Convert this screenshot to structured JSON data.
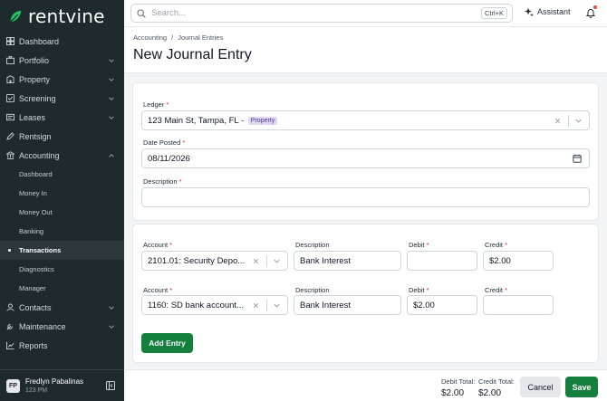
{
  "app": {
    "brand": "rentvine",
    "brand_color": "#15803d",
    "sidebar_bg": "#1f2a2e"
  },
  "topbar": {
    "search_placeholder": "Search...",
    "search_shortcut": "Ctrl+K",
    "assistant_label": "Assistant",
    "notifications_unread": true
  },
  "sidebar": {
    "items": [
      {
        "label": "Dashboard",
        "icon": "dashboard-icon"
      },
      {
        "label": "Portfolio",
        "icon": "portfolio-icon",
        "expandable": true
      },
      {
        "label": "Property",
        "icon": "building-icon",
        "expandable": true
      },
      {
        "label": "Screening",
        "icon": "screening-icon",
        "expandable": true
      },
      {
        "label": "Leases",
        "icon": "lease-icon",
        "expandable": true
      },
      {
        "label": "Rentsign",
        "icon": "pen-icon"
      },
      {
        "label": "Accounting",
        "icon": "bank-icon",
        "expandable": true,
        "expanded": true
      }
    ],
    "accounting_sub": [
      {
        "label": "Dashboard"
      },
      {
        "label": "Money In"
      },
      {
        "label": "Money Out"
      },
      {
        "label": "Banking"
      },
      {
        "label": "Transactions",
        "active": true
      },
      {
        "label": "Diagnostics"
      },
      {
        "label": "Manager"
      }
    ],
    "items_after": [
      {
        "label": "Contacts",
        "icon": "contacts-icon",
        "expandable": true
      },
      {
        "label": "Maintenance",
        "icon": "wrench-icon",
        "expandable": true
      },
      {
        "label": "Reports",
        "icon": "chart-icon"
      }
    ],
    "user": {
      "initials": "FP",
      "name": "Fredlyn Pabalinas",
      "subtitle": "123 PM"
    }
  },
  "header": {
    "breadcrumb": [
      "Accounting",
      "Journal Entries"
    ],
    "breadcrumb_sep": "/",
    "title": "New Journal Entry"
  },
  "form": {
    "ledger": {
      "label": "Ledger",
      "value": "123 Main St, Tampa, FL -",
      "badge": "Property"
    },
    "date_posted": {
      "label": "Date Posted",
      "value": "08/11/2026"
    },
    "description": {
      "label": "Description",
      "value": ""
    }
  },
  "lines": {
    "headers": {
      "account": "Account",
      "description": "Description",
      "debit": "Debit",
      "credit": "Credit"
    },
    "rows": [
      {
        "account": "2101.01: Security Depo...",
        "description": "Bank Interest",
        "debit": "",
        "credit": "$2.00"
      },
      {
        "account": "1160: SD bank account...",
        "description": "Bank Interest",
        "debit": "$2.00",
        "credit": ""
      }
    ],
    "add_label": "Add Entry"
  },
  "footer": {
    "debit_total_label": "Debit Total:",
    "debit_total": "$2.00",
    "credit_total_label": "Credit Total:",
    "credit_total": "$2.00",
    "cancel_label": "Cancel",
    "save_label": "Save"
  }
}
